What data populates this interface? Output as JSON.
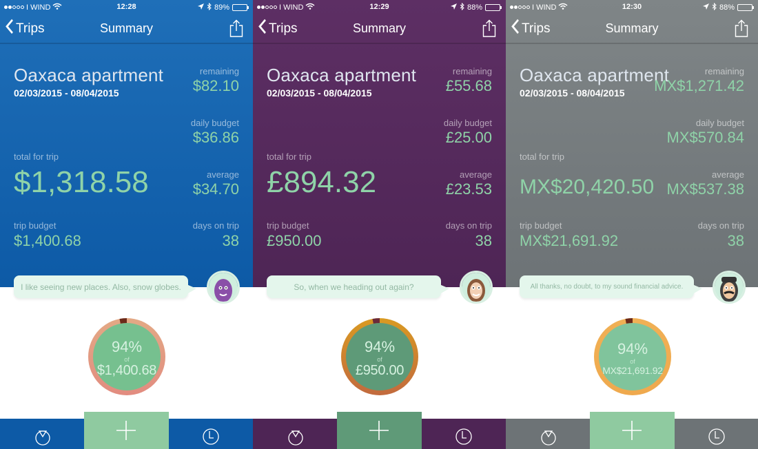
{
  "common": {
    "back_label": "Trips",
    "nav_title": "Summary",
    "carrier": "I WIND",
    "trip_name": "Oaxaca apartment",
    "trip_dates": "02/03/2015 - 08/04/2015",
    "labels": {
      "remaining": "remaining",
      "daily_budget": "daily budget",
      "total_for_trip": "total for trip",
      "average": "average",
      "trip_budget": "trip budget",
      "days_on_trip": "days on trip",
      "of": "of"
    },
    "icons": {
      "back": "chevron-left-icon",
      "share": "share-icon",
      "tab_left": "ring-icon",
      "add": "plus-icon",
      "tab_right": "clock-icon"
    }
  },
  "screens": [
    {
      "theme": "blue",
      "colors": {
        "bg_top": "#1f6fb8",
        "bg_bottom": "#0d5aa6",
        "add": "#8fcaa0",
        "gauge_ring": "#e3a985",
        "gauge_ring_low": "#e28c80",
        "gauge_fill": "#76c08f",
        "gauge_marker": "#6b2a1a"
      },
      "status": {
        "time": "12:28",
        "battery": "89%",
        "battery_level": 0.89
      },
      "remaining": "$82.10",
      "daily_budget": "$36.86",
      "total_for_trip": "$1,318.58",
      "average": "$34.70",
      "trip_budget": "$1,400.68",
      "days_on_trip": "38",
      "speech": "I like seeing new places. Also, snow globes.",
      "avatar": "purple-monster-avatar",
      "gauge": {
        "percent_label": "94%",
        "percent": 94,
        "amount": "$1,400.68"
      }
    },
    {
      "theme": "purple",
      "colors": {
        "bg_top": "#5d2f64",
        "bg_bottom": "#4e2555",
        "add": "#5f9a78",
        "gauge_ring": "#d99a22",
        "gauge_ring_low": "#c26a3e",
        "gauge_fill": "#5e9a78",
        "gauge_marker": "#6b2a3a"
      },
      "status": {
        "time": "12:29",
        "battery": "88%",
        "battery_level": 0.88
      },
      "remaining": "£55.68",
      "daily_budget": "£25.00",
      "total_for_trip": "£894.32",
      "average": "£23.53",
      "trip_budget": "£950.00",
      "days_on_trip": "38",
      "speech": "So, when we heading out again?",
      "avatar": "woman-avatar",
      "gauge": {
        "percent_label": "94%",
        "percent": 94,
        "amount": "£950.00"
      }
    },
    {
      "theme": "gray",
      "colors": {
        "bg_top": "#7f8587",
        "bg_bottom": "#6d7376",
        "add": "#8fcaa0",
        "gauge_ring": "#f0b055",
        "gauge_ring_low": "#efa94e",
        "gauge_fill": "#80c49c",
        "gauge_marker": "#6b2a1a"
      },
      "status": {
        "time": "12:30",
        "battery": "88%",
        "battery_level": 0.88
      },
      "remaining": "MX$1,271.42",
      "daily_budget": "MX$570.84",
      "total_for_trip": "MX$20,420.50",
      "average": "MX$537.38",
      "trip_budget": "MX$21,691.92",
      "days_on_trip": "38",
      "speech": "All thanks, no doubt, to my sound financial advice.",
      "avatar": "mustached-man-avatar",
      "gauge": {
        "percent_label": "94%",
        "percent": 94,
        "amount": "MX$21,691.92"
      }
    }
  ]
}
